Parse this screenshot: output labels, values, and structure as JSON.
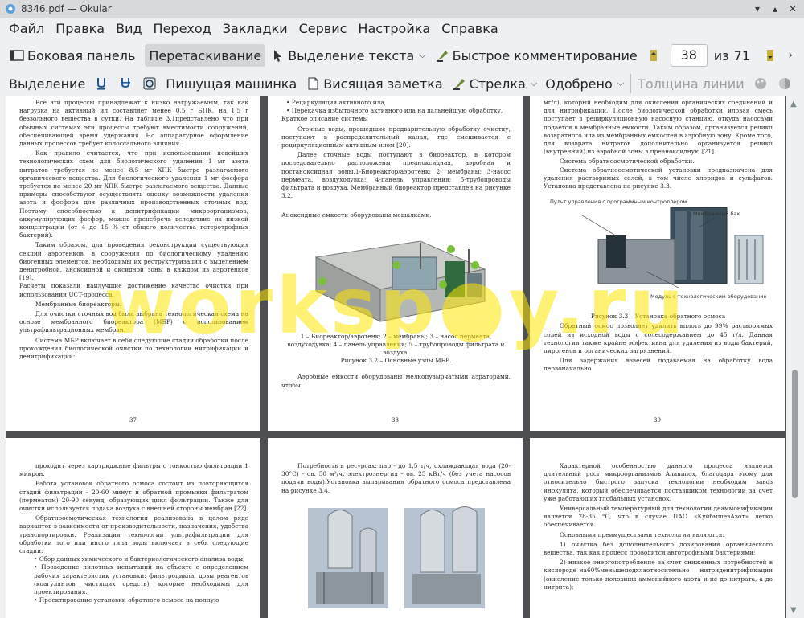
{
  "window": {
    "title": "8346.pdf  — Okular"
  },
  "menu": [
    "Файл",
    "Правка",
    "Вид",
    "Переход",
    "Закладки",
    "Сервис",
    "Настройка",
    "Справка"
  ],
  "toolbar1": {
    "sidebar": "Боковая панель",
    "drag": "Перетаскивание",
    "text_select": "Выделение текста",
    "quick_comment": "Быстрое комментирование",
    "page_current": "38",
    "page_of": "из",
    "page_total": "71"
  },
  "toolbar2": {
    "select": "Выделение",
    "typewriter": "Пишущая машинка",
    "note": "Висящая заметка",
    "arrow": "Стрелка",
    "approved": "Одобрено",
    "line_width": "Толщина линии"
  },
  "watermark": "worksp●y.ru",
  "pages": {
    "p37": {
      "number": "37",
      "paras": [
        "Все эти процессы принадлежат к низко нагружаемым, так как нагрузка на активный ил составляет менее 0,5 г БПК, на 1,5 г беззольного вещества в сутки. На таблице 3.1представлено что при обычных системах эти процессы требуют вместимости сооружений, обеспечивающей время удержания. Но аппаратурное оформление данных процессов требует колоссального влияния.",
        "Как правило считается, что при использовании новейших технологических схем для биологического удаления 1 мг азота нитратов требуется не менее 8,5 мг ХПК быстро разлагаемого органического вещества. Для биологического удаления 1 мг фосфора требуется не менее 20 мг ХПК быстро разлагаемого вещества. Данные примеры способствуют осуществлять оценку возможности удаления азота и фосфора для различных производственных сточных вод. Поэтому способностью к денитрификации микроорганизмов, аккумулирующих фосфор, можно пренебречь вследствие их низкой концентрации (от 4 до 15 % от общего количества гетеротрофных бактерий).",
        "Таким образом, для проведения реконструкции существующих секций аэротенков, в сооружения по биологическому удалению биогенных элементов, необходимы их реструктуризация с выделением денитробной, аноксидной и оксидной зоны в каждом из аэротенков [19].",
        "Расчеты показали наилучшие достижение качество очистки при использовании UCT-процесса.",
        "Мембранные биореакторы.",
        "Для очистки сточных вод была выбрана технологическая схема на основе мембранного биореактора (МБР) с использованием ультрафильтрационных мембран.",
        "Система МБР включает в себя следующие стадии обработки после прохождения биологической очистки по технологии нитрификации и денитрификации:"
      ]
    },
    "p38": {
      "number": "38",
      "bullets": [
        "Рециркуляция активного ила,",
        "Перекачка избыточного активного ила на дальнейшую обработку."
      ],
      "heading": "Краткое описание системы",
      "paras": [
        "Сточные воды, прошедшие предварительную обработку очистку, поступают в распределительный канал, где смешивается с рециркуляционным активным илом [20].",
        "Далее сточные воды поступают в биореактор, в котором последовательно расположены преаноксидная, аэробная и постаноксидная зоны.1-Биореактор/аэротенк; 2- мембраны; 3-насос пермеата, воздуходувка; 4-панель управления; 5-трубопроводы фильтрата и воздуха. Мембранный биореактор представлен на рисунке 3.2."
      ],
      "fig_title": "Аноксидные емкости оборудованы мешалками.",
      "caption": "1 – Биореактор/аэротенк; 2 – мембраны; 3 – насос пермеата, воздуходувка; 4 – панель управления; 5 – трубопроводы фильтрата и воздуха.",
      "fig_label": "Рисунок 3.2 – Основные узлы МБР.",
      "last": "Аэробные емкости оборудованы мелкопузырчатыми аэраторами, чтобы"
    },
    "p39": {
      "number": "39",
      "paras": [
        "мг/л), который необходим для окисления органических соединений и для нитрификации. После биологической обработки иловая смесь поступает в рециркуляционную насосную станцию, откуда насосами подается в мембранные емкости. Таким образом, организуется рецикл возвратного ила из мембранных емкостей в аэробную зону. Кроме того, для возврата нитратов дополнительно организуется рецикл (внутренний) из аэробной зоны в преаноксидную [21].",
        "Система обратноосмотической обработки.",
        "Система обратноосмотической установки предназначена для удаления растворимых солей, в том числе хлоридов и сульфатов. Установка представлена на рисунке 3.3."
      ],
      "labels": [
        "Пульт управления с программным контроллером",
        "Мембранный бак",
        "Модуль с технологическим оборудованием"
      ],
      "fig_label": "Рисунок 3.3 – Установка обратного осмоса",
      "after": [
        "Обратный осмос позволяет удалить вплоть до 99% растворимых солей из исходной воды с солесодержанием до 45 г/л. Данная технология также крайне эффективна для удаления из воды бактерий, пирогенов и органических загрязнений.",
        "Для задержания взвесей подаваемая на обработку вода первоначально"
      ]
    },
    "p40": {
      "paras": [
        "проходит через картриджные фильтры с тонкостью фильтрации 1 микрон.",
        "Работа установок обратного осмоса состоит из повторяющихся стадий фильтрации - 20-60 минут и обратной промывки фильтратом (пермеатом) 20-90 секунд, образующих цикл фильтрации. Также для очистки используется подача воздуха с внешней стороны мембран [22].",
        "Обратноосмотическая технология реализована в целом ряде вариантов в зависимости от производительности, назначения, удобства транспортировки. Реализация технологии ультрафильтрации для обработки того или иного типа воды включает в себя следующие стадии:"
      ],
      "bullets": [
        "Сбор данных химического и бактериологического анализа воды;",
        "Проведение пилотных испытаний на объекте с определением рабочих характеристик установки: фильтроцикла, дозы реагентов (коагулянтов, чистящих средств), которые необходимы для проектирования.",
        "Проектирование установки обратного осмоса на полную"
      ]
    },
    "p41": {
      "paras": [
        "Потребность в ресурсах: пар - до 1,5 т/ч, охлаждающая вода (20-30°С) - ов. 50 м³/ч, электроэнергия - ов. 25 кВт/ч (без учета насосов подачи воды).Установка выпаривания обратного осмоса представлена на рисунке 3.4."
      ]
    },
    "p42": {
      "paras": [
        "Характерной особенностью данного процесса является длительный рост микроорганизмов Anammox, благодаря этому для относительно быстрого запуска технологии необходим завоз инокулята, который обеспечивается поставщиком технологии за счет уже работающих глобальных установок.",
        "Универсальный температурный для технологии деаммонификации является 28-35 °С, что в случае ПАО «КуйбышевАзот» легко обеспечивается.",
        "Основными преимуществами технологии являются:",
        "1)  очистка без дополнительного дозирования органического вещества, так как процесс проводится автотрофными бактериями;",
        "2)  низкое энергопотребление за счет сниженных потребностей в кислороде–на60%меньшеподхлаотносительно нитриденитрификации (окисление только половины аммонийного азота и не до нитрата, а до нитрита);"
      ]
    }
  }
}
